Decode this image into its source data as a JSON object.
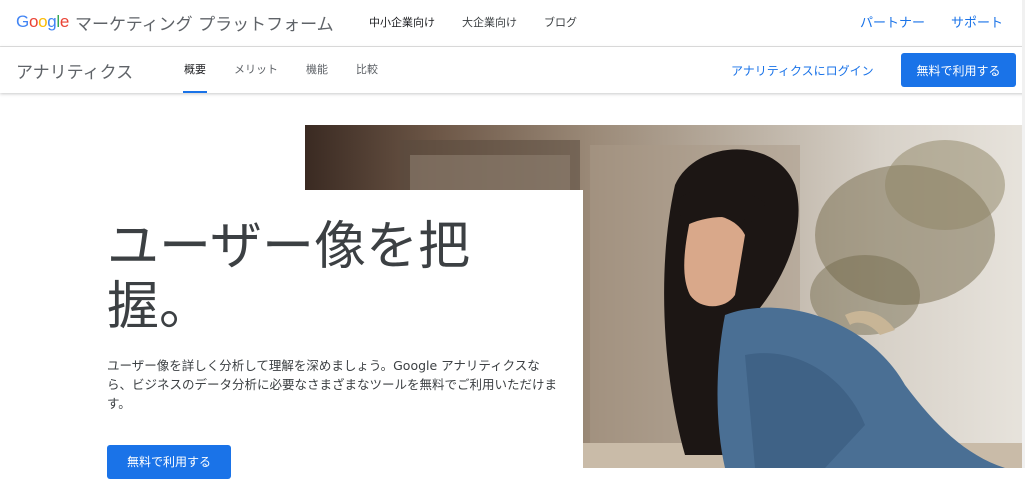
{
  "header": {
    "brand": "Google",
    "product": "マーケティング プラットフォーム",
    "nav": [
      "中小企業向け",
      "大企業向け",
      "ブログ"
    ],
    "right_links": [
      "パートナー",
      "サポート"
    ],
    "brand_colors": [
      "#4285F4",
      "#EA4335",
      "#FBBC05",
      "#4285F4",
      "#34A853",
      "#EA4335"
    ]
  },
  "subnav": {
    "title": "アナリティクス",
    "tabs": [
      "概要",
      "メリット",
      "機能",
      "比較"
    ],
    "active_tab": "概要",
    "login": "アナリティクスにログイン",
    "cta": "無料で利用する"
  },
  "hero": {
    "title": "ユーザー像を把握。",
    "description": "ユーザー像を詳しく分析して理解を深めましょう。Google アナリティクスなら、ビジネスのデータ分析に必要なさまざまなツールを無料でご利用いただけます。",
    "cta": "無料で利用する"
  },
  "colors": {
    "accent": "#1a73e8",
    "text": "#3c4043"
  }
}
